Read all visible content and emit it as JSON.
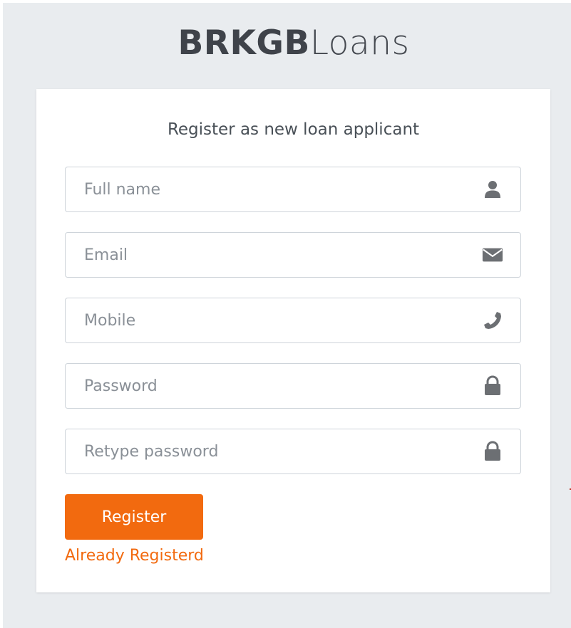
{
  "logo": {
    "bold": "BRKGB",
    "light": "Loans"
  },
  "form": {
    "title": "Register as new loan applicant",
    "fields": [
      {
        "placeholder": "Full name",
        "value": "",
        "icon": "user-icon"
      },
      {
        "placeholder": "Email",
        "value": "",
        "icon": "envelope-icon"
      },
      {
        "placeholder": "Mobile",
        "value": "",
        "icon": "phone-icon"
      },
      {
        "placeholder": "Password",
        "value": "",
        "icon": "lock-icon"
      },
      {
        "placeholder": "Retype password",
        "value": "",
        "icon": "lock-icon"
      }
    ],
    "register_label": "Register",
    "login_link": "Already Registerd"
  },
  "colors": {
    "accent": "#f26a0f",
    "background": "#e9ecef",
    "icon": "#6c6f73",
    "text": "#495057"
  }
}
